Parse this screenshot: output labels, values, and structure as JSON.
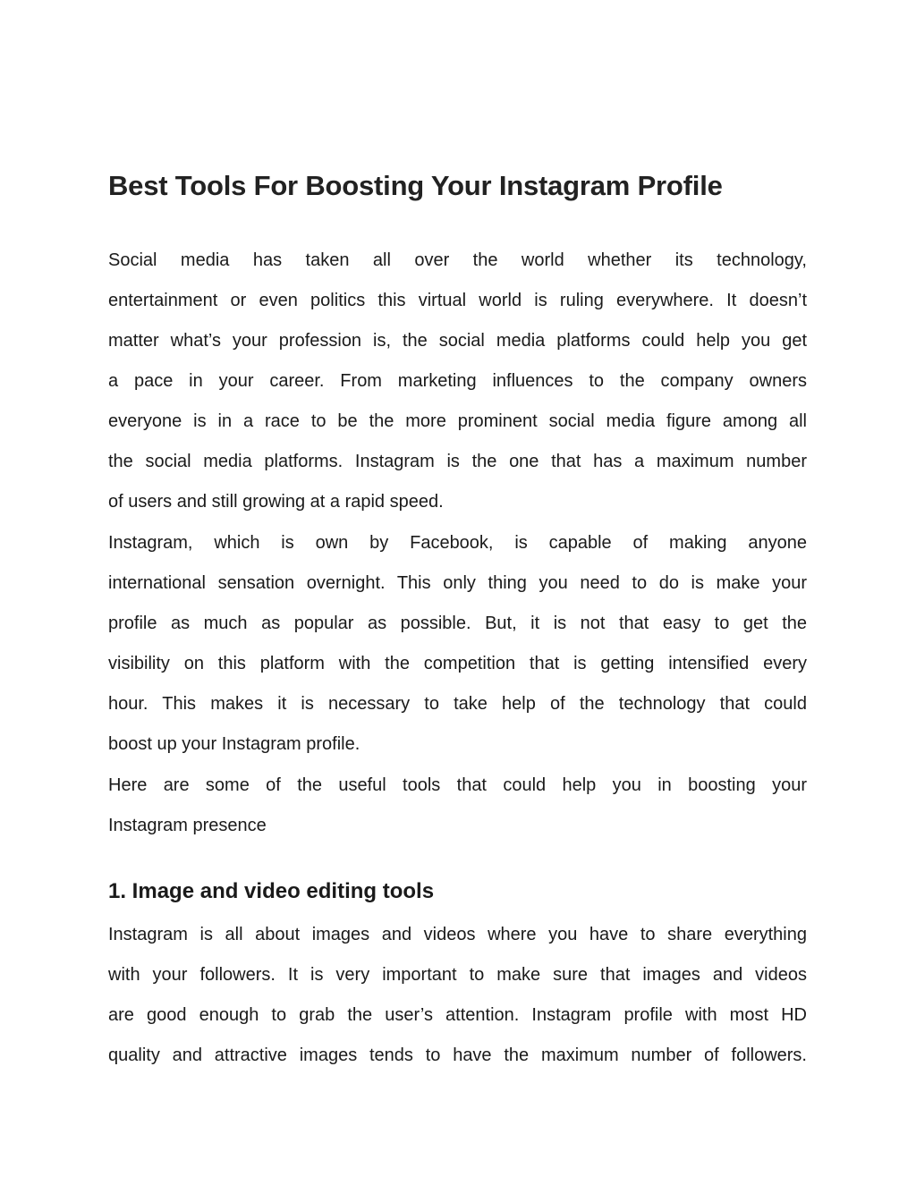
{
  "document": {
    "title": "Best Tools For Boosting Your Instagram Profile",
    "paragraphs": [
      {
        "lines": [
          "Social media has taken all over the world whether its technology,",
          "entertainment or even politics this virtual world is ruling everywhere. It doesn’t",
          "matter what’s your profession is, the social media platforms could help you get",
          "a pace in your career. From marketing influences to the company owners",
          "everyone is in a race to be the more prominent social media figure among all",
          "the social media platforms. Instagram is the one that has a maximum number",
          "of users and still growing at a rapid speed."
        ]
      },
      {
        "lines": [
          "Instagram, which is own by Facebook, is capable of making anyone",
          "international sensation overnight. This only thing you need to do is make your",
          "profile as much as popular as possible. But, it is not that easy to get the",
          "visibility on this platform with the competition that is getting intensified every",
          "hour. This makes it is necessary to take help of the technology that could",
          "boost up your Instagram profile."
        ]
      },
      {
        "lines": [
          "Here are some of the useful tools that could help you in boosting your",
          "Instagram presence"
        ]
      }
    ],
    "sections": [
      {
        "heading": "1. Image and video editing tools",
        "lines": [
          "Instagram is all about images and videos where you have to share everything",
          "with your followers. It is very important to make sure that images and videos",
          "are good enough to grab the user’s attention. Instagram profile with most HD",
          "quality and attractive images tends to have the maximum number of followers."
        ]
      }
    ]
  }
}
